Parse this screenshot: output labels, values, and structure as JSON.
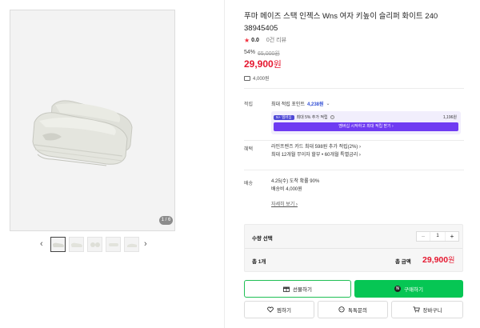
{
  "gallery": {
    "counter": "1 / 6",
    "prev_arrow": "‹",
    "next_arrow": "›",
    "thumb_count": 5
  },
  "product": {
    "title": "푸마 메이즈 스택 인젝스 Wns 여자 키높이 슬리퍼 화이트 240 38945405",
    "rating": "0.0",
    "reviews": "0건 리뷰",
    "discount": "54%",
    "original_price": "65,000원",
    "sale_price": "29,900",
    "sale_price_unit": "원",
    "shipping_cost": "4,000원"
  },
  "points": {
    "label": "적립",
    "text": "최대 적립 포인트",
    "value": "4,238원",
    "chevron": "⌄"
  },
  "membership": {
    "tag": "N+ 멤버십",
    "text": "최대 5% 추가 적립",
    "amount": "1,196원",
    "cta": "멤버십 시작하고 최대 적립 받기 ›"
  },
  "benefits": {
    "label": "혜택",
    "line1": "라인프렌즈 카드 최대 598원 추가 적립(2%) ›",
    "line2": "최대 12개월 무이자 할부 • 60개월 특별금리 ›"
  },
  "delivery": {
    "label": "배송",
    "line1": "4.25(수) 도착 확률 90%",
    "line2": "배송비 4,000원",
    "detail_link": "자세히 보기 ›"
  },
  "order": {
    "option_label": "수량 선택",
    "minus": "−",
    "quantity": "1",
    "plus": "+",
    "total_count": "총 1개",
    "total_label": "총 금액",
    "total_price": "29,900",
    "total_unit": "원"
  },
  "buttons": {
    "gift": "선물하기",
    "buy": "구매하기",
    "buy_badge": "N",
    "wish": "찜하기",
    "talk": "톡톡문의",
    "cart": "장바구니"
  },
  "colors": {
    "sale_red": "#e5172f",
    "naver_green": "#06c654",
    "membership_purple": "#6f3bf2",
    "point_blue": "#3552d6"
  }
}
